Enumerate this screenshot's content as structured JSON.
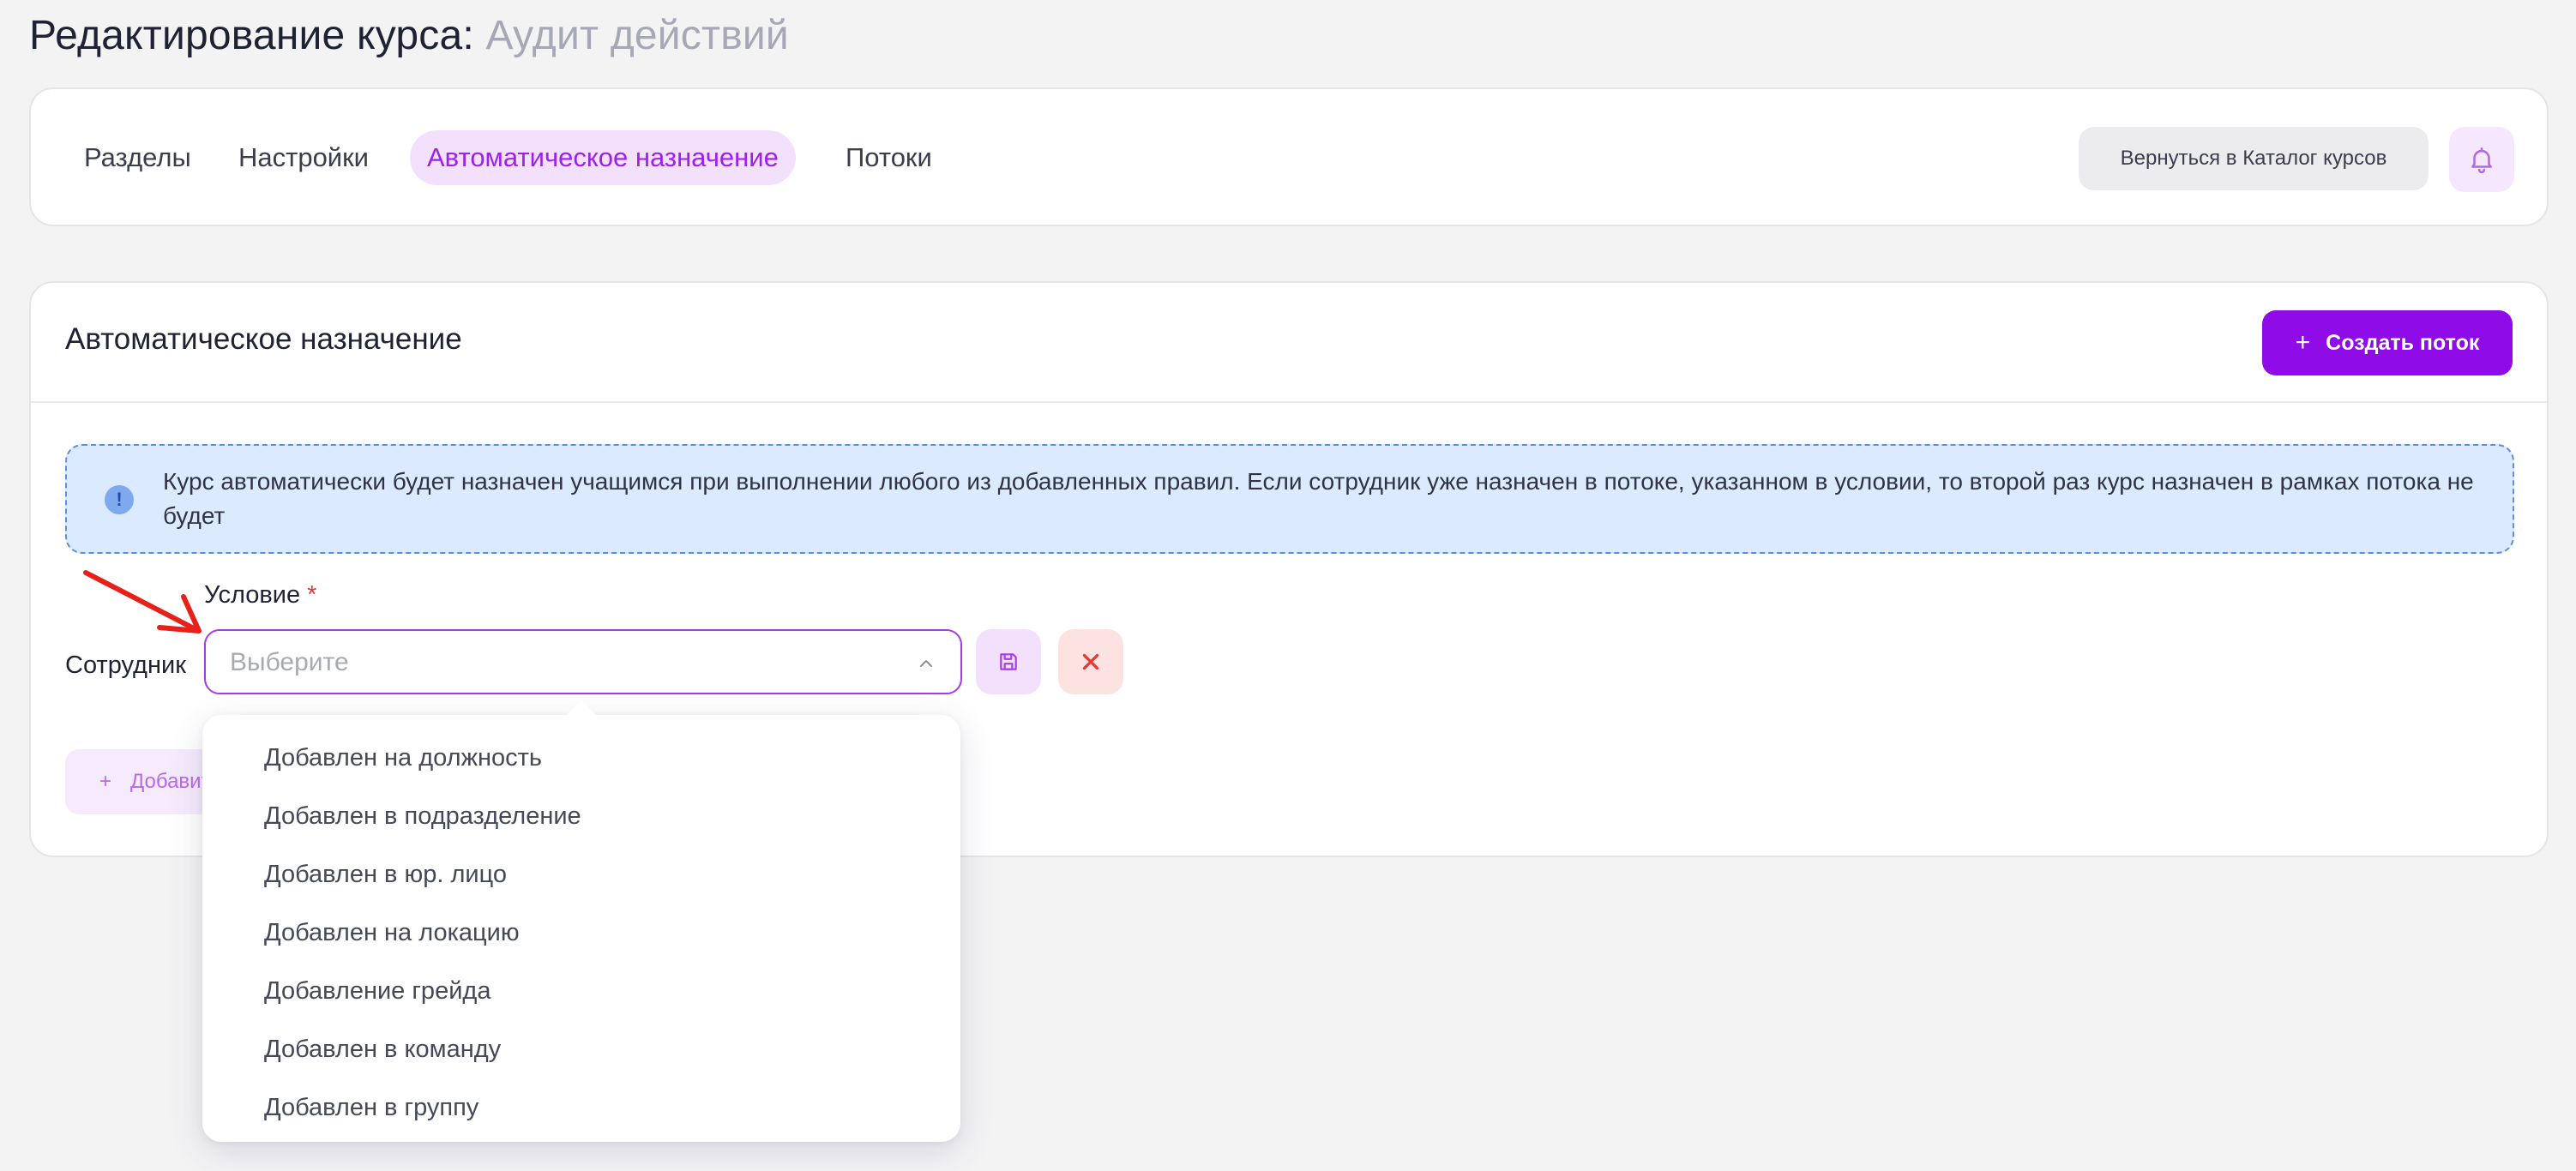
{
  "page": {
    "title_prefix": "Редактирование курса:",
    "course_name": "Аудит действий"
  },
  "tabs": [
    {
      "label": "Разделы"
    },
    {
      "label": "Настройки"
    },
    {
      "label": "Автоматическое назначение",
      "active": true
    },
    {
      "label": "Потоки"
    }
  ],
  "header_actions": {
    "back_label": "Вернуться в Каталог курсов",
    "bell_icon": "bell-icon"
  },
  "section": {
    "title": "Автоматическое назначение",
    "create_label": "Создать поток",
    "create_icon": "+"
  },
  "info": {
    "icon": "!",
    "text": "Курс автоматически будет назначен учащимся при выполнении любого из добавленных правил. Если сотрудник уже назначен в потоке, указанном в условии, то второй раз курс назначен в рамках потока не будет"
  },
  "rule": {
    "condition_label": "Условие",
    "required_mark": "*",
    "subject_label": "Сотрудник",
    "select_placeholder": "Выберите",
    "add_rule_label": "Добавить",
    "add_icon": "+"
  },
  "dropdown": {
    "options": [
      "Добавлен на должность",
      "Добавлен в подразделение",
      "Добавлен в юр. лицо",
      "Добавлен на локацию",
      "Добавление грейда",
      "Добавлен в команду",
      "Добавлен в группу"
    ]
  },
  "colors": {
    "accent": "#8f0be8",
    "accent_soft": "#f2e0fd",
    "danger": "#e53935",
    "info_bg": "#dceaff",
    "annotation": "#e8201a"
  }
}
